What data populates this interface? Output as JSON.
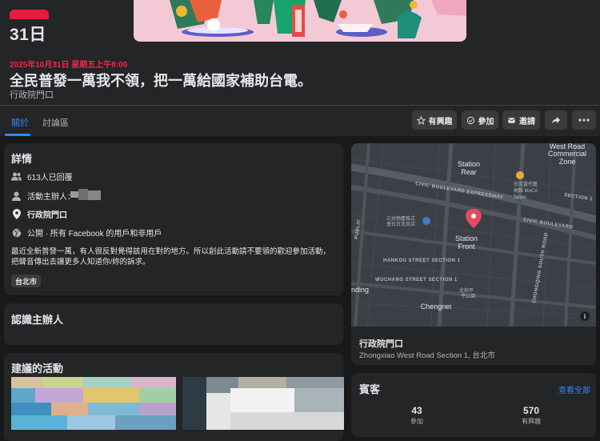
{
  "event": {
    "day_label": "31日",
    "datetime": "2025年10月31日 星期五上午8:00",
    "title": "全民普發一萬我不領，把一萬給國家補助台電。",
    "location": "行政院門口"
  },
  "tabs": [
    {
      "label": "關於",
      "active": true
    },
    {
      "label": "討論區",
      "active": false
    }
  ],
  "actions": {
    "interested": "有興趣",
    "going": "參加",
    "invite": "邀請"
  },
  "details": {
    "title": "詳情",
    "responded": "613人已回覆",
    "host_prefix": "活動主辦人：",
    "location": "行政院門口",
    "privacy": "公開 · 所有 Facebook 的用戶和非用戶",
    "description": "最近全新普發一萬，有人很反對覺得該用在對的地方。所以創此活動請不要領的歡迎參加活動，把聲音傳出去讓更多人知道你/妳的訴求。",
    "tag": "台北市"
  },
  "hosts_card": {
    "title": "認識主辦人"
  },
  "suggested": {
    "title": "建議的活動"
  },
  "map": {
    "labels": [
      "West Road",
      "Commercial",
      "Zone",
      "Station",
      "Rear",
      "Station",
      "Front",
      "Chengnei",
      "nding",
      "PUBLIC",
      "台北當代藝",
      "術館 MoCA",
      "Taipei",
      "CIVIC BOULEVARD EXPRESSWAY",
      "CIVIC BOULEVARD",
      "HANKOU STREET SECTION 1",
      "WUCHANG STREET SECTION 1",
      "CHONGQING SOUTH ROAD",
      "SECTION 1",
      "三井物產株式",
      "會社台北支店",
      "北和平",
      "平公園"
    ],
    "place": "行政院門口",
    "address": "Zhongxiao West Road Section 1, 台北市"
  },
  "guests": {
    "title": "賓客",
    "see_all": "查看全部",
    "going_count": "43",
    "going_label": "參加",
    "interested_count": "570",
    "interested_label": "有興趣"
  },
  "colors": {
    "background": "#18191a",
    "card": "#242526",
    "accent": "#2d88ff",
    "date_red": "#f02849",
    "map_bg": "#3b4047"
  }
}
